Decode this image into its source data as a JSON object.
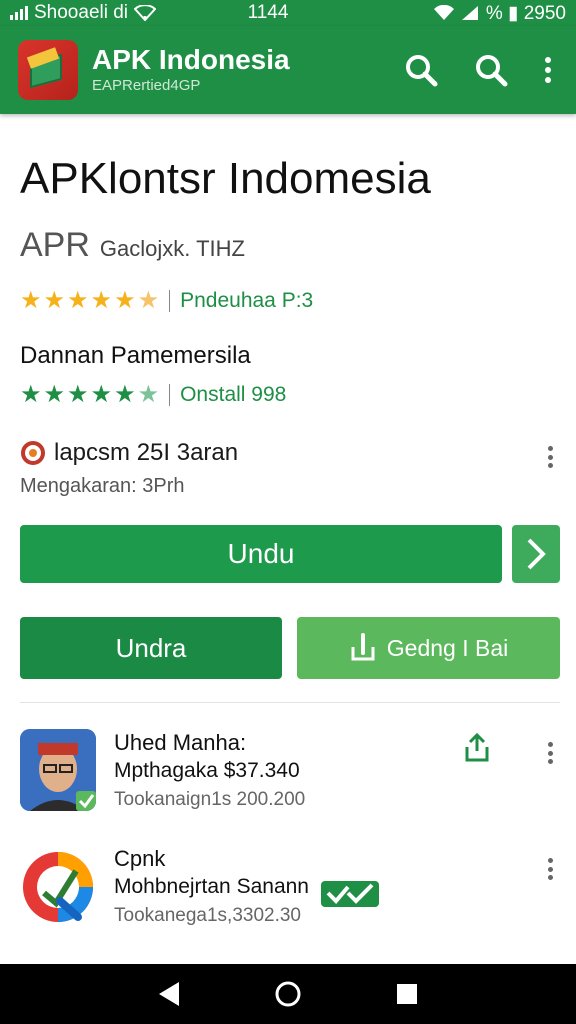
{
  "status_bar": {
    "carrier": "Shooaeli di",
    "time": "1144",
    "battery_text": "% ▮ 2950"
  },
  "app_bar": {
    "title": "APK Indonesia",
    "subtitle": "EAPRertied4GP",
    "icons": [
      "app-logo-icon",
      "search-icon",
      "search-icon",
      "more-vert-icon"
    ]
  },
  "app": {
    "title": "APKlontsr Indomesia",
    "developer_code": "APR",
    "developer_name": "Gaclojxk. TIHZ",
    "rating_primary": {
      "stars": 4.5,
      "label": "Pndeuhaa P:3"
    },
    "section_label": "Dannan Pamemersila",
    "rating_secondary": {
      "stars": 4.5,
      "label": "Onstall 998"
    },
    "info": {
      "title": "lapcsm 25I 3aran",
      "subtitle": "Mengakaran: 3Prh"
    }
  },
  "buttons": {
    "primary": "Undu",
    "secondary": "Undra",
    "share": "Gedng I Bai"
  },
  "related": [
    {
      "title": "Uhed Manha:",
      "subtitle": "Mpthagaka $37.340",
      "meta": "Tookanaign1s 200.200",
      "thumb": "person-avatar"
    },
    {
      "title": "Cpnk",
      "subtitle": "Mohbnejrtan Sanann",
      "meta": "Tookanega1s,3302.30",
      "thumb": "app-logo-google-style"
    }
  ],
  "colors": {
    "primary_green": "#1e8f45",
    "button_green": "#1e9a4c",
    "light_green": "#5cb85c",
    "star_gold": "#f5b21b",
    "star_green": "#1e8f45"
  }
}
